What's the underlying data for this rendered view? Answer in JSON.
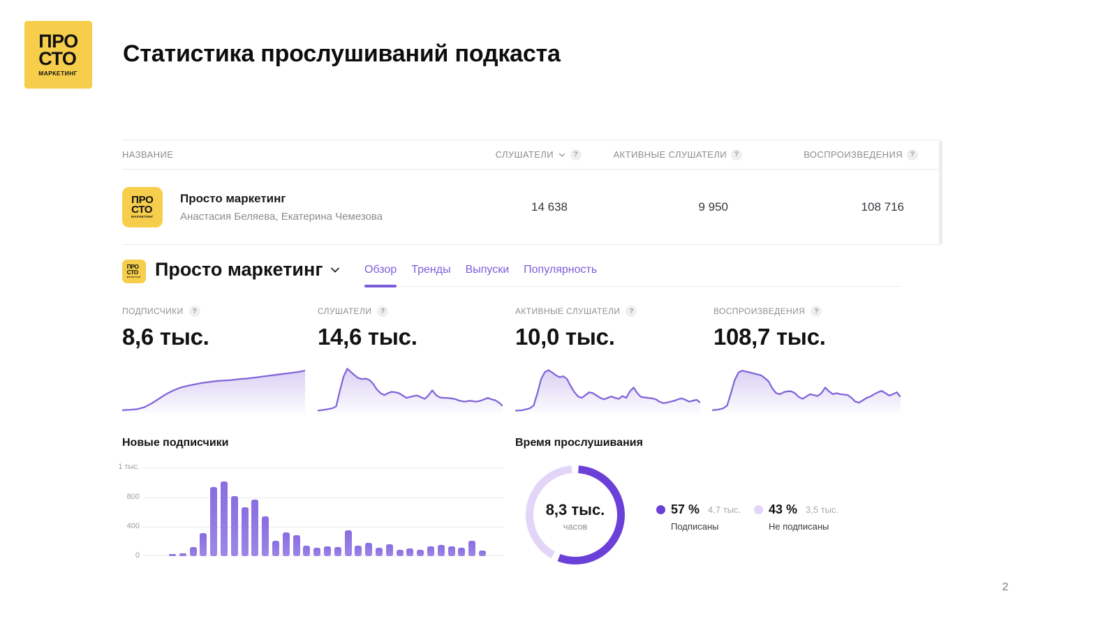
{
  "page": {
    "title": "Статистика прослушиваний подкаста",
    "number": "2"
  },
  "ui": {
    "help": "?"
  },
  "brand": {
    "logo_line1": "ПРО",
    "logo_line2": "СТО",
    "logo_line3": "МАРКЕТИНГ"
  },
  "colors": {
    "accent": "#7C5CDB",
    "spark_stroke": "#8266D9",
    "bar": "#8A6EDF",
    "donut_dark": "#6B40D8",
    "donut_light": "#E3D5F8",
    "brand_yellow": "#F6CE4B"
  },
  "table": {
    "columns": {
      "name": "НАЗВАНИЕ",
      "listeners": "СЛУШАТЕЛИ",
      "active_listeners": "АКТИВНЫЕ СЛУШАТЕЛИ",
      "plays": "ВОСПРОИЗВЕДЕНИЯ"
    },
    "row": {
      "title": "Просто маркетинг",
      "authors": "Анастасия Беляева, Екатерина Чемезова",
      "listeners": "14 638",
      "active_listeners": "9 950",
      "plays": "108 716"
    }
  },
  "selector": {
    "title": "Просто маркетинг",
    "tabs": [
      {
        "label": "Обзор",
        "active": true
      },
      {
        "label": "Тренды",
        "active": false
      },
      {
        "label": "Выпуски",
        "active": false
      },
      {
        "label": "Популярность",
        "active": false
      }
    ]
  },
  "chart_data": [
    {
      "id": "subscribers",
      "type": "area",
      "label": "ПОДПИСЧИКИ",
      "value": "8,6 тыс.",
      "profile": [
        [
          0,
          4
        ],
        [
          5,
          5
        ],
        [
          8,
          6
        ],
        [
          12,
          10
        ],
        [
          16,
          18
        ],
        [
          20,
          28
        ],
        [
          24,
          38
        ],
        [
          28,
          46
        ],
        [
          32,
          52
        ],
        [
          36,
          56
        ],
        [
          40,
          59
        ],
        [
          44,
          62
        ],
        [
          48,
          64
        ],
        [
          52,
          66
        ],
        [
          56,
          67
        ],
        [
          60,
          68
        ],
        [
          64,
          70
        ],
        [
          68,
          71
        ],
        [
          72,
          73
        ],
        [
          76,
          75
        ],
        [
          80,
          77
        ],
        [
          84,
          79
        ],
        [
          88,
          81
        ],
        [
          92,
          83
        ],
        [
          96,
          85
        ],
        [
          100,
          88
        ]
      ]
    },
    {
      "id": "listeners",
      "type": "area",
      "label": "СЛУШАТЕЛИ",
      "value": "14,6 тыс.",
      "profile": [
        [
          0,
          3
        ],
        [
          4,
          5
        ],
        [
          8,
          8
        ],
        [
          10,
          12
        ],
        [
          12,
          45
        ],
        [
          14,
          75
        ],
        [
          16,
          92
        ],
        [
          18,
          85
        ],
        [
          20,
          78
        ],
        [
          22,
          72
        ],
        [
          24,
          70
        ],
        [
          26,
          71
        ],
        [
          28,
          68
        ],
        [
          30,
          60
        ],
        [
          32,
          48
        ],
        [
          34,
          40
        ],
        [
          36,
          36
        ],
        [
          38,
          40
        ],
        [
          40,
          43
        ],
        [
          42,
          42
        ],
        [
          44,
          40
        ],
        [
          46,
          35
        ],
        [
          48,
          30
        ],
        [
          50,
          32
        ],
        [
          52,
          34
        ],
        [
          54,
          35
        ],
        [
          56,
          31
        ],
        [
          58,
          28
        ],
        [
          60,
          36
        ],
        [
          62,
          46
        ],
        [
          64,
          36
        ],
        [
          66,
          31
        ],
        [
          68,
          30
        ],
        [
          70,
          30
        ],
        [
          72,
          29
        ],
        [
          74,
          28
        ],
        [
          76,
          25
        ],
        [
          78,
          23
        ],
        [
          80,
          22
        ],
        [
          82,
          24
        ],
        [
          84,
          23
        ],
        [
          86,
          22
        ],
        [
          88,
          24
        ],
        [
          90,
          27
        ],
        [
          92,
          30
        ],
        [
          94,
          27
        ],
        [
          96,
          25
        ],
        [
          98,
          20
        ],
        [
          100,
          13
        ]
      ]
    },
    {
      "id": "active_listeners",
      "type": "area",
      "label": "АКТИВНЫЕ СЛУШАТЕЛИ",
      "value": "10,0 тыс.",
      "profile": [
        [
          0,
          3
        ],
        [
          4,
          4
        ],
        [
          8,
          8
        ],
        [
          10,
          14
        ],
        [
          12,
          40
        ],
        [
          14,
          70
        ],
        [
          16,
          85
        ],
        [
          18,
          89
        ],
        [
          20,
          84
        ],
        [
          22,
          78
        ],
        [
          24,
          74
        ],
        [
          26,
          76
        ],
        [
          28,
          70
        ],
        [
          30,
          55
        ],
        [
          32,
          42
        ],
        [
          34,
          33
        ],
        [
          36,
          30
        ],
        [
          38,
          36
        ],
        [
          40,
          42
        ],
        [
          42,
          40
        ],
        [
          44,
          35
        ],
        [
          46,
          30
        ],
        [
          48,
          27
        ],
        [
          50,
          30
        ],
        [
          52,
          33
        ],
        [
          54,
          30
        ],
        [
          56,
          28
        ],
        [
          58,
          34
        ],
        [
          60,
          30
        ],
        [
          62,
          44
        ],
        [
          64,
          52
        ],
        [
          66,
          40
        ],
        [
          68,
          32
        ],
        [
          70,
          31
        ],
        [
          72,
          30
        ],
        [
          74,
          29
        ],
        [
          76,
          27
        ],
        [
          78,
          22
        ],
        [
          80,
          19
        ],
        [
          82,
          20
        ],
        [
          84,
          22
        ],
        [
          86,
          24
        ],
        [
          88,
          27
        ],
        [
          90,
          29
        ],
        [
          92,
          26
        ],
        [
          94,
          22
        ],
        [
          96,
          24
        ],
        [
          98,
          26
        ],
        [
          100,
          20
        ]
      ]
    },
    {
      "id": "plays",
      "type": "area",
      "label": "ВОСПРОИЗВЕДЕНИЯ",
      "value": "108,7 тыс.",
      "profile": [
        [
          0,
          4
        ],
        [
          3,
          5
        ],
        [
          6,
          8
        ],
        [
          8,
          14
        ],
        [
          10,
          40
        ],
        [
          12,
          68
        ],
        [
          14,
          84
        ],
        [
          16,
          88
        ],
        [
          18,
          86
        ],
        [
          20,
          84
        ],
        [
          22,
          82
        ],
        [
          24,
          80
        ],
        [
          26,
          78
        ],
        [
          28,
          72
        ],
        [
          30,
          65
        ],
        [
          32,
          50
        ],
        [
          34,
          40
        ],
        [
          36,
          38
        ],
        [
          38,
          42
        ],
        [
          40,
          44
        ],
        [
          42,
          44
        ],
        [
          44,
          40
        ],
        [
          46,
          32
        ],
        [
          48,
          28
        ],
        [
          50,
          33
        ],
        [
          52,
          38
        ],
        [
          54,
          36
        ],
        [
          56,
          34
        ],
        [
          58,
          40
        ],
        [
          60,
          52
        ],
        [
          62,
          44
        ],
        [
          64,
          38
        ],
        [
          66,
          40
        ],
        [
          68,
          38
        ],
        [
          70,
          37
        ],
        [
          72,
          36
        ],
        [
          74,
          30
        ],
        [
          76,
          22
        ],
        [
          78,
          20
        ],
        [
          80,
          25
        ],
        [
          82,
          30
        ],
        [
          84,
          33
        ],
        [
          86,
          38
        ],
        [
          88,
          42
        ],
        [
          90,
          45
        ],
        [
          92,
          40
        ],
        [
          94,
          35
        ],
        [
          96,
          38
        ],
        [
          98,
          42
        ],
        [
          100,
          32
        ]
      ]
    },
    {
      "id": "new_subscribers",
      "type": "bar",
      "title": "Новые подписчики",
      "values": [
        25,
        35,
        120,
        310,
        930,
        1010,
        810,
        660,
        760,
        540,
        210,
        320,
        280,
        140,
        110,
        130,
        120,
        350,
        140,
        175,
        110,
        160,
        85,
        105,
        85,
        130,
        150,
        130,
        110,
        210,
        75
      ],
      "y_ticks": [
        "1 тыс.",
        "800",
        "400",
        "0"
      ],
      "y_tick_values": [
        1000,
        800,
        400,
        0
      ],
      "ylim": [
        0,
        1200
      ]
    },
    {
      "id": "listening_time",
      "type": "donut",
      "title": "Время прослушивания",
      "center_value": "8,3 тыс.",
      "center_label": "часов",
      "slices": [
        {
          "pct": "57 %",
          "value": 57,
          "amount": "4,7 тыс.",
          "label": "Подписаны",
          "color": "#6B40D8"
        },
        {
          "pct": "43 %",
          "value": 43,
          "amount": "3,5 тыс.",
          "label": "Не подписаны",
          "color": "#E3D5F8"
        }
      ]
    }
  ]
}
